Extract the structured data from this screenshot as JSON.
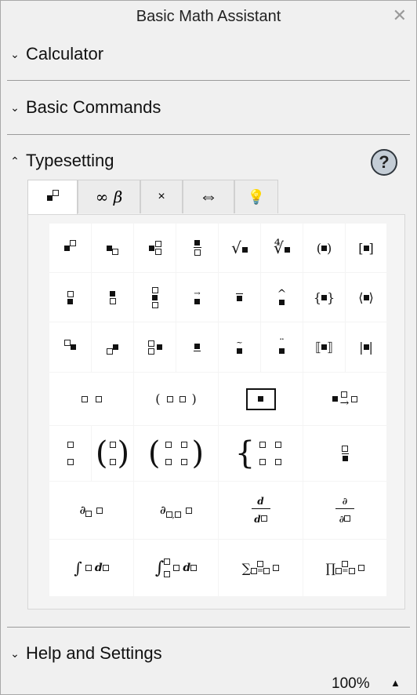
{
  "window": {
    "title": "Basic Math Assistant"
  },
  "sections": {
    "calculator": "Calculator",
    "basic_commands": "Basic Commands",
    "typesetting": "Typesetting",
    "help_settings": "Help and Settings"
  },
  "help_button": "?",
  "tabs": [
    {
      "label": "",
      "icon": "power-template-icon"
    },
    {
      "label": "∞ β",
      "icon": ""
    },
    {
      "label": "×",
      "icon": ""
    },
    {
      "label": "⇔",
      "icon": ""
    },
    {
      "label": "",
      "icon": "lightbulb-icon"
    }
  ],
  "symbols": {
    "sqrt": "√",
    "nthroot": "∜",
    "paren_l": "(",
    "paren_r": ")",
    "brack_l": "[",
    "brack_r": "]",
    "brace_l": "{",
    "brace_r": "}",
    "angle_l": "⟨",
    "angle_r": "⟩",
    "dbl_l": "⟦",
    "dbl_r": "⟧",
    "abs": "|",
    "big_paren_l": "(",
    "big_paren_r": ")",
    "big_brace": "{",
    "partial": "∂",
    "d": "d",
    "integral": "∫",
    "sum": "∑",
    "prod": "∏",
    "eq": "=",
    "arrow": "→",
    "hat": "^",
    "tilde_dots": "¨"
  },
  "footer": {
    "zoom": "100%"
  },
  "colors": {
    "help_fill": "#c4cdd6",
    "background": "#f0f0f0",
    "cell": "#ffffff"
  }
}
